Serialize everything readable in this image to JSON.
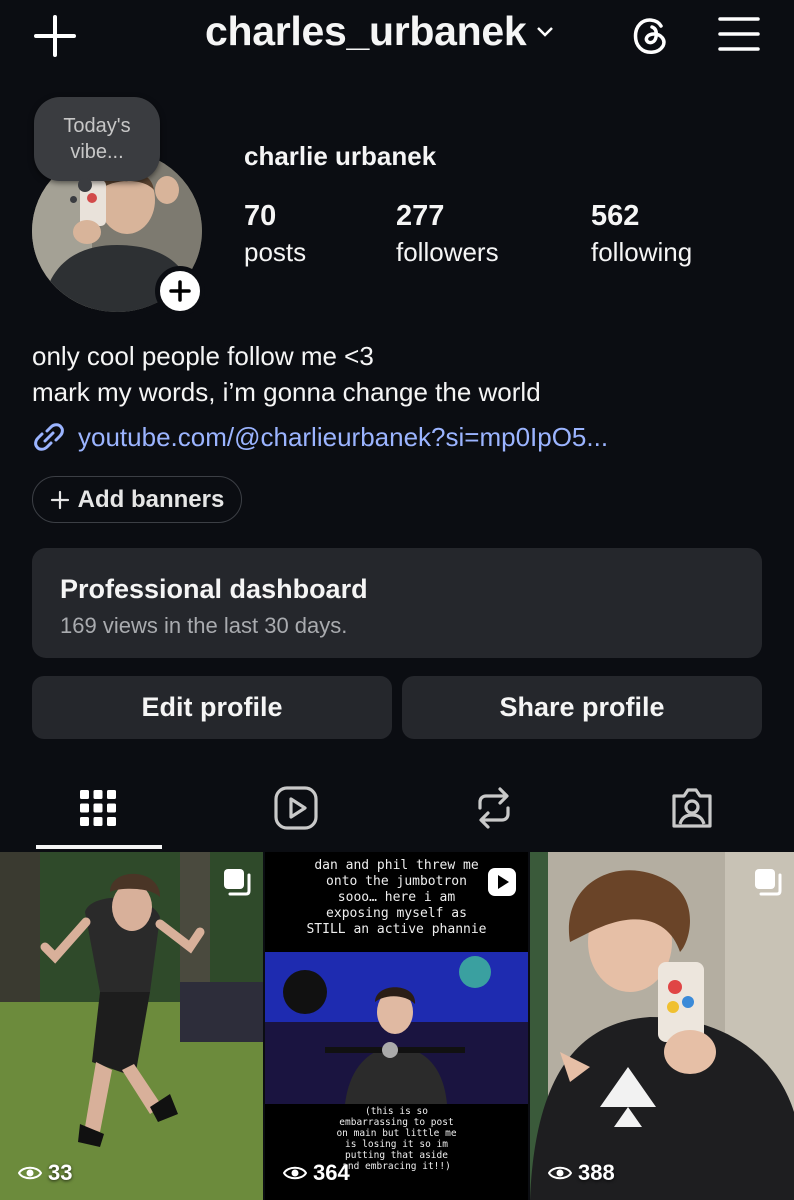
{
  "header": {
    "handle": "charles_urbanek",
    "icons": {
      "create": "plus-icon",
      "handle_dropdown": "chevron-down-icon",
      "threads": "threads-icon",
      "menu": "hamburger-menu-icon"
    }
  },
  "profile": {
    "note": "Today's vibe...",
    "full_name": "charlie urbanek",
    "stats": {
      "posts": {
        "value": "70",
        "label": "posts"
      },
      "followers": {
        "value": "277",
        "label": "followers"
      },
      "following": {
        "value": "562",
        "label": "following"
      }
    },
    "bio_line1": "only cool people follow me <3",
    "bio_line2": "mark my words, i’m gonna change the world",
    "link": "youtube.com/@charlieurbanek?si=mp0IpO5...",
    "add_banners": "Add banners"
  },
  "dashboard": {
    "title": "Professional dashboard",
    "subtitle": "169 views in the last 30 days."
  },
  "buttons": {
    "edit": "Edit profile",
    "share": "Share profile"
  },
  "tabs": [
    {
      "name": "posts-grid",
      "icon": "grid-icon",
      "active": true
    },
    {
      "name": "reels",
      "icon": "reels-icon",
      "active": false
    },
    {
      "name": "reposts",
      "icon": "repost-icon",
      "active": false
    },
    {
      "name": "tagged",
      "icon": "tagged-icon",
      "active": false
    }
  ],
  "posts": [
    {
      "views": "33",
      "badge": "carousel-icon"
    },
    {
      "views": "364",
      "badge": "video-icon",
      "caption_top": "dan and phil threw me onto the jumbotron sooo… here i am exposing myself as STILL an active phannie",
      "caption_bottom": "(this is so embarrassing to post on main but little me is losing it so im putting that aside and embracing it!!)"
    },
    {
      "views": "388",
      "badge": "carousel-icon"
    }
  ],
  "colors": {
    "background": "#0b0d12",
    "card": "#25272c",
    "link": "#9bb4ff",
    "muted": "#a9abaf"
  }
}
